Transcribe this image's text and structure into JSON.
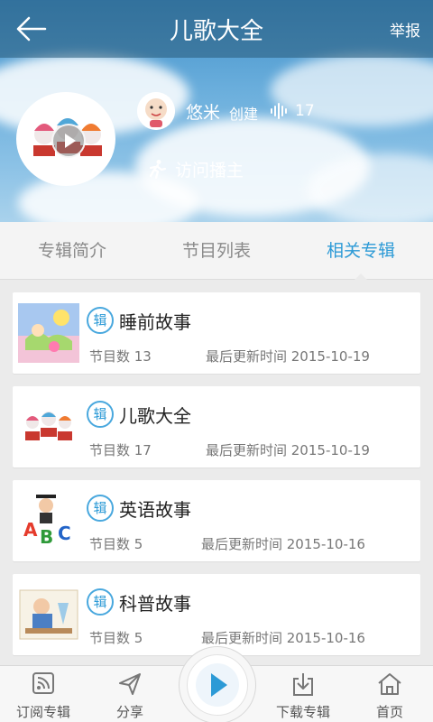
{
  "header": {
    "title": "儿歌大全",
    "report_label": "举报",
    "back_icon": "back-arrow-icon"
  },
  "album": {
    "creator_name": "悠米",
    "created_label": "创建",
    "program_count": "17",
    "visit_label": "访问播主"
  },
  "tabs": [
    {
      "label": "专辑简介",
      "active": false
    },
    {
      "label": "节目列表",
      "active": false
    },
    {
      "label": "相关专辑",
      "active": true
    }
  ],
  "related_albums": [
    {
      "badge": "辑",
      "title": "睡前故事",
      "count": "节目数 13",
      "updated": "最后更新时间 2015-10-19"
    },
    {
      "badge": "辑",
      "title": "儿歌大全",
      "count": "节目数 17",
      "updated": "最后更新时间 2015-10-19"
    },
    {
      "badge": "辑",
      "title": "英语故事",
      "count": "节目数 5",
      "updated": "最后更新时间 2015-10-16"
    },
    {
      "badge": "辑",
      "title": "科普故事",
      "count": "节目数 5",
      "updated": "最后更新时间 2015-10-16"
    }
  ],
  "bottom_nav": {
    "subscribe": "订阅专辑",
    "share": "分享",
    "download": "下载专辑",
    "home": "首页"
  },
  "colors": {
    "accent": "#2c9ad6",
    "topbar": "#2f5f7f",
    "text_muted": "#777777"
  }
}
